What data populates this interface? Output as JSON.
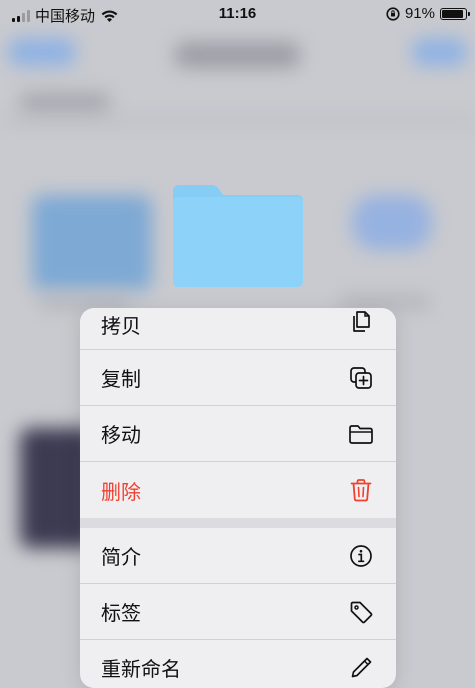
{
  "status_bar": {
    "carrier": "中国移动",
    "time": "11:16",
    "battery_percent": "91%",
    "battery_level": 0.91
  },
  "context_menu": {
    "items": [
      {
        "label": "拷贝",
        "icon": "copy-document-icon"
      },
      {
        "label": "复制",
        "icon": "duplicate-plus-icon"
      },
      {
        "label": "移动",
        "icon": "folder-icon"
      },
      {
        "label": "删除",
        "icon": "trash-icon",
        "destructive": true
      },
      {
        "label": "简介",
        "icon": "info-icon"
      },
      {
        "label": "标签",
        "icon": "tag-icon"
      },
      {
        "label": "重新命名",
        "icon": "pencil-icon"
      }
    ]
  },
  "colors": {
    "folder": "#8dd1f8",
    "destructive": "#f0402f",
    "menu_background": "#efeff2"
  }
}
